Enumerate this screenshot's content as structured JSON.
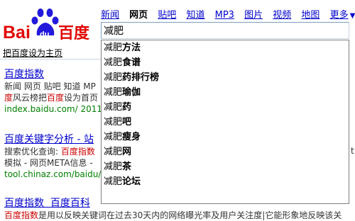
{
  "logo": {
    "text_left": "Bai",
    "text_paw": "du",
    "text_right": "百度"
  },
  "nav": {
    "items": [
      "新闻",
      "网页",
      "贴吧",
      "知道",
      "MP3",
      "图片",
      "视频",
      "地图"
    ],
    "active_index": 1,
    "more_label": "更多",
    "more_arrow": "▼"
  },
  "search": {
    "value": "减肥"
  },
  "suggestions": [
    {
      "prefix": "减肥",
      "suffix": "方法"
    },
    {
      "prefix": "减肥",
      "suffix": "食谱"
    },
    {
      "prefix": "减肥",
      "suffix": "药排行榜"
    },
    {
      "prefix": "减肥",
      "suffix": "瑜伽"
    },
    {
      "prefix": "减肥",
      "suffix": "药"
    },
    {
      "prefix": "减肥",
      "suffix": "吧"
    },
    {
      "prefix": "减肥",
      "suffix": "瘦身"
    },
    {
      "prefix": "减肥",
      "suffix": "网"
    },
    {
      "prefix": "减肥",
      "suffix": "茶"
    },
    {
      "prefix": "减肥",
      "suffix": "论坛"
    }
  ],
  "set_home": "把百度设为主页",
  "results": [
    {
      "title": "百度指数",
      "line1": "新闻 网页 贴吧 知道 MP",
      "line2_hl": "度",
      "line2_rest": "风云榜把",
      "line2_hl2": "百度",
      "line2_tail": "设为首页",
      "url": "index.baidu.com/ 2011-"
    },
    {
      "title": "百度关键字分析 - 站",
      "line1_plain": "搜索优化查询: ",
      "line1_hl": "百度指数",
      "line2": "模拟 - 网页META信息 -",
      "url": "tool.chinaz.com/baidu/w"
    },
    {
      "title_a": "百度指数",
      "title_b": "百度百科",
      "line1_hl": "百度指数",
      "line1_rest": "是用以反映关键词在过去30天内的网络曝光率及用户关注度|它能形象地反映该关"
    }
  ],
  "scroll_mark": "t"
}
